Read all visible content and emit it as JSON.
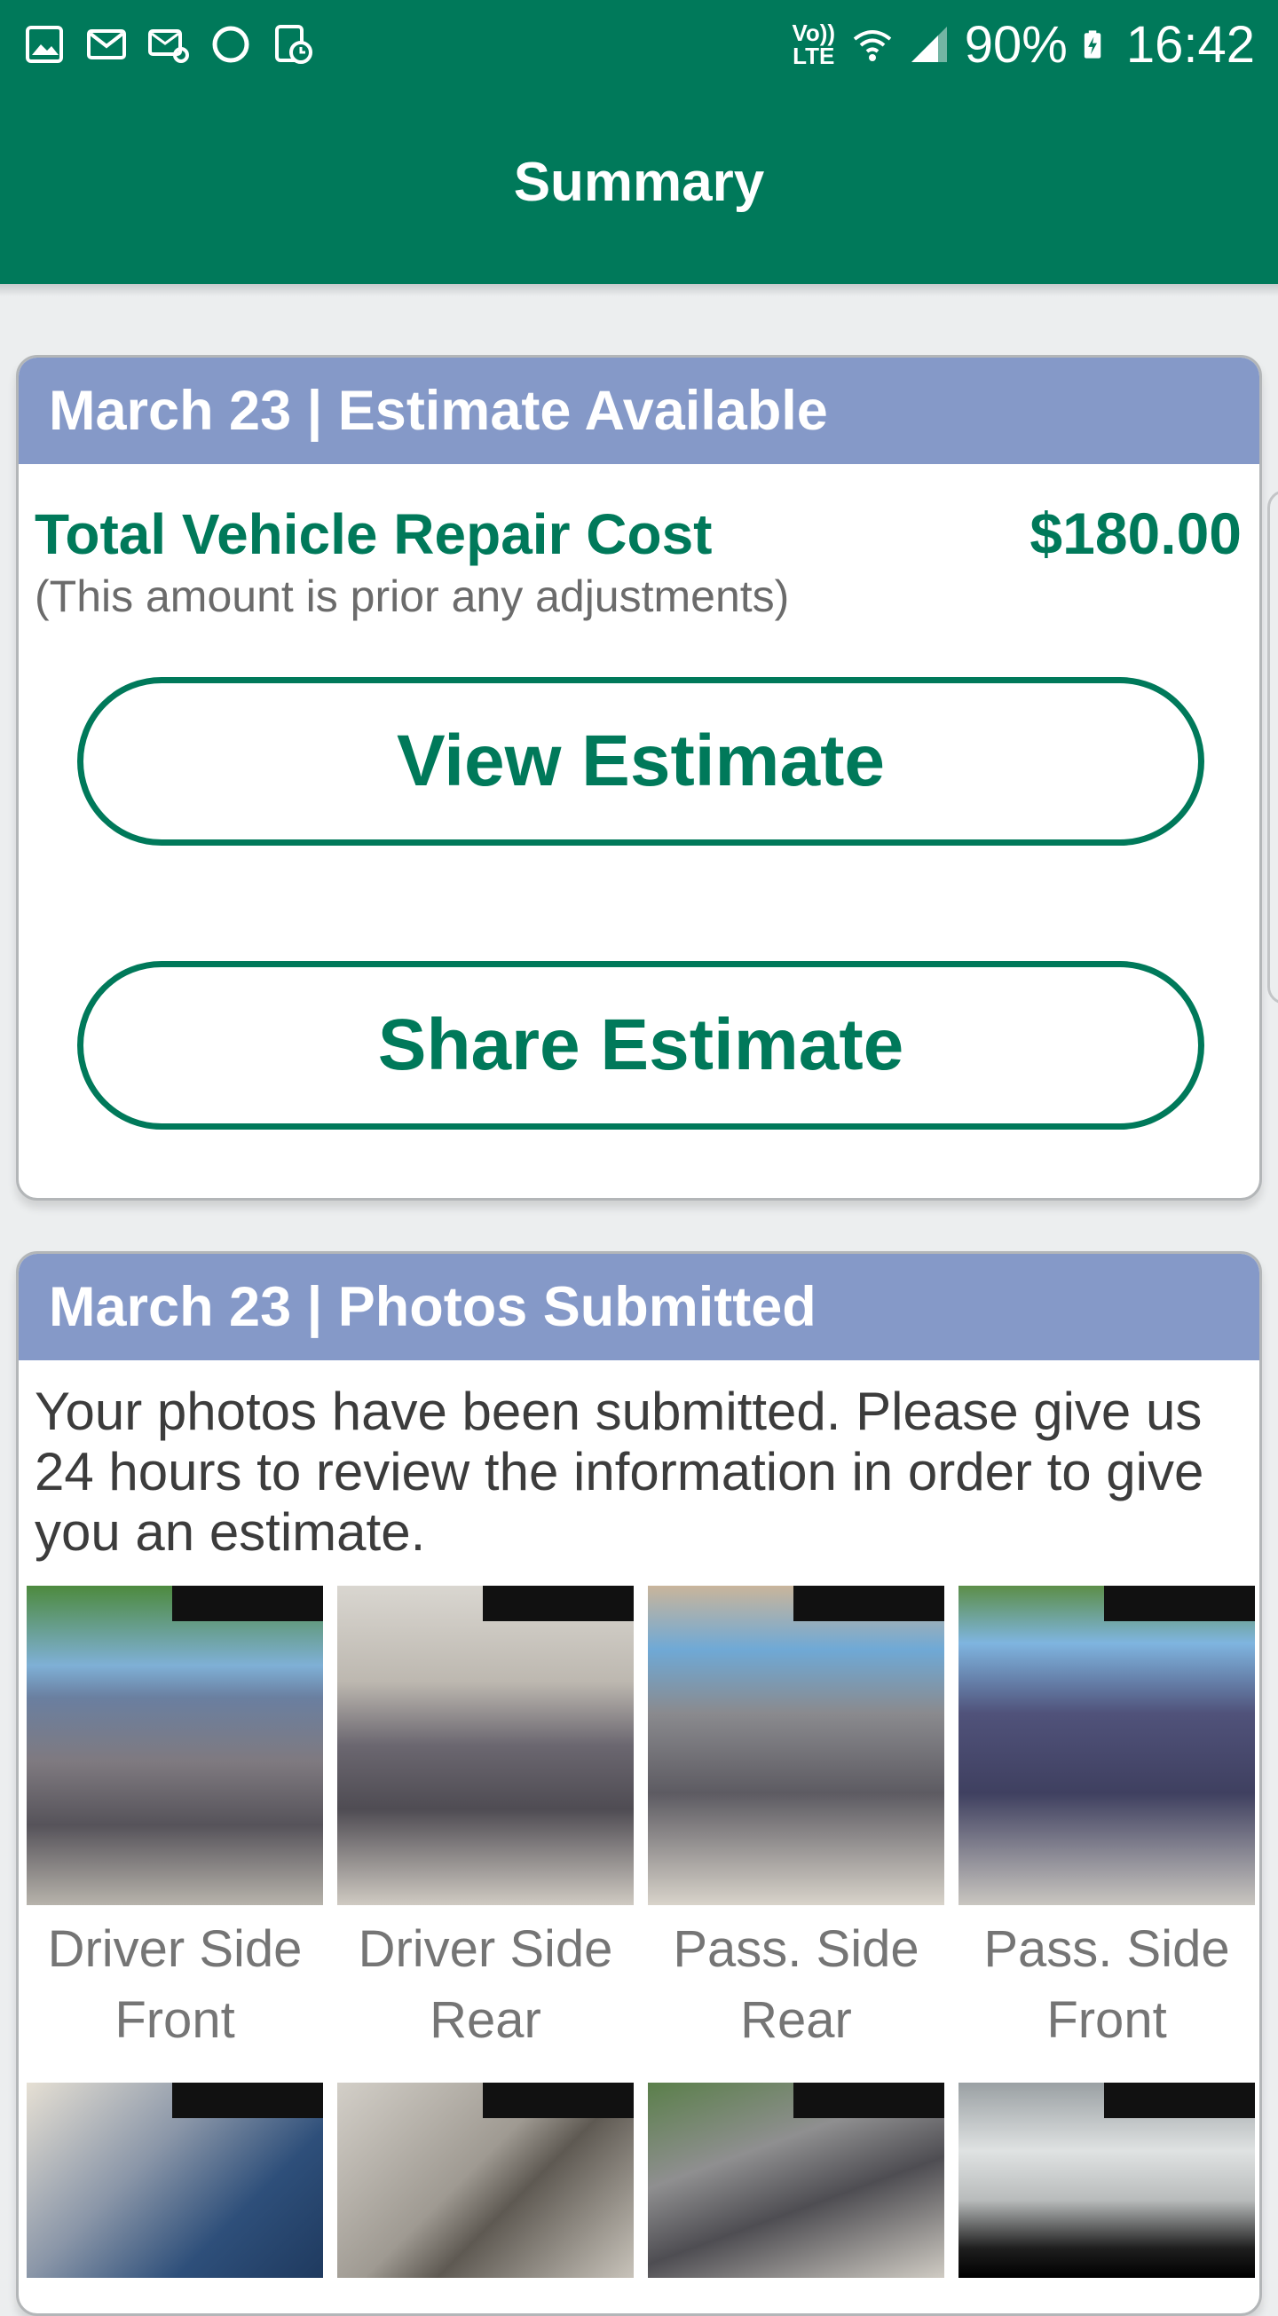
{
  "status_bar": {
    "battery": "90%",
    "time": "16:42",
    "volte": "Vo)) LTE",
    "left_icons": [
      "gallery-icon",
      "mail-icon",
      "mail-settings-icon",
      "circle-icon",
      "device-clock-icon"
    ],
    "right_icons": [
      "wifi-icon",
      "signal-icon",
      "battery-charging-icon"
    ]
  },
  "app_bar": {
    "title": "Summary"
  },
  "estimate_card": {
    "header": "March 23 | Estimate Available",
    "total_label": "Total Vehicle Repair Cost",
    "total_value": "$180.00",
    "note": "(This amount is prior any adjustments)",
    "view_button": "View Estimate",
    "share_button": "Share Estimate"
  },
  "photos_card": {
    "header": "March 23 | Photos Submitted",
    "message": "Your photos have been submitted. Please give us 24 hours to review the information in order to give you an estimate.",
    "photos": [
      {
        "label": "Driver Side Front"
      },
      {
        "label": "Driver Side Rear"
      },
      {
        "label": "Pass. Side Rear"
      },
      {
        "label": "Pass. Side Front"
      },
      {
        "label": ""
      },
      {
        "label": ""
      },
      {
        "label": ""
      },
      {
        "label": ""
      }
    ]
  },
  "colors": {
    "primary_green": "#00795a",
    "header_blue": "#8599c8",
    "background": "#eceeef"
  }
}
